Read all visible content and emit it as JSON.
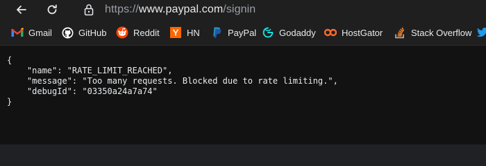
{
  "address_bar": {
    "url_prefix": "https://",
    "url_host": "www.paypal.com",
    "url_path": "/signin"
  },
  "bookmarks": [
    {
      "label": "Gmail",
      "icon": "gmail-icon"
    },
    {
      "label": "GitHub",
      "icon": "github-icon"
    },
    {
      "label": "Reddit",
      "icon": "reddit-icon"
    },
    {
      "label": "HN",
      "icon": "hacker-news-icon"
    },
    {
      "label": "PayPal",
      "icon": "paypal-icon"
    },
    {
      "label": "Godaddy",
      "icon": "godaddy-icon"
    },
    {
      "label": "HostGator",
      "icon": "hostgator-icon"
    },
    {
      "label": "Stack Overflow",
      "icon": "stack-overflow-icon"
    }
  ],
  "json_response": {
    "open_brace": "{",
    "line_name": "    \"name\": \"RATE_LIMIT_REACHED\",",
    "line_message": "    \"message\": \"Too many requests. Blocked due to rate limiting.\",",
    "line_debug": "    \"debugId\": \"03350a24a7a74\"",
    "close_brace": "}"
  },
  "colors": {
    "background": "#121212",
    "toolbar": "#1f1f1f",
    "text": "#e8eaed",
    "url_dim": "#9aa0a6"
  }
}
